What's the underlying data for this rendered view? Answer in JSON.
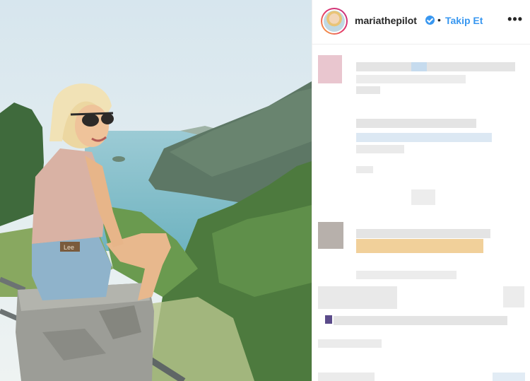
{
  "post": {
    "username": "mariathepilot",
    "separator": "•",
    "follow_label": "Takip Et",
    "more_label": "•••"
  },
  "photo": {
    "brand_label": "Lee"
  },
  "colors": {
    "accent": "#3897f0",
    "text": "#262626",
    "divider": "#efefef"
  }
}
